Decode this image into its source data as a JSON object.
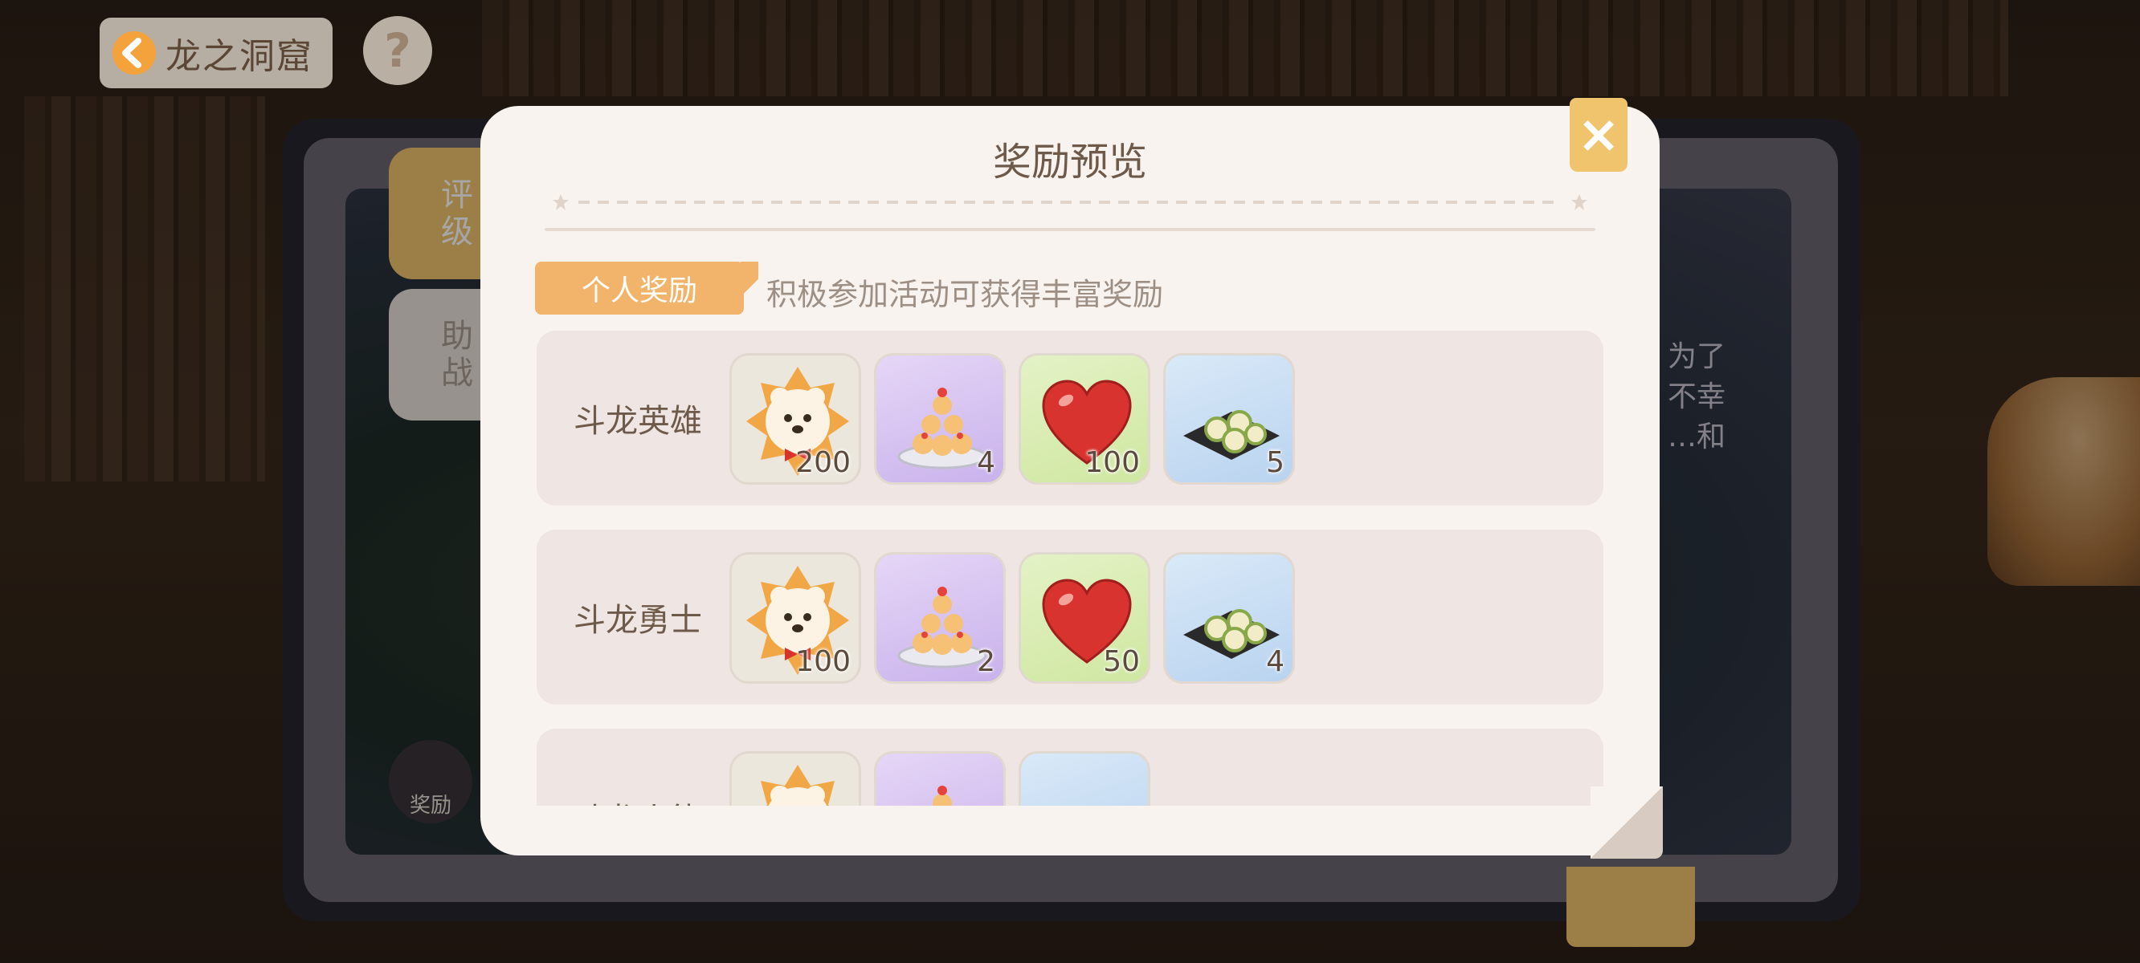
{
  "header": {
    "title": "龙之洞窟",
    "help": "?"
  },
  "tabs": [
    {
      "label_line1": "评",
      "label_line2": "级"
    },
    {
      "label_line1": "助",
      "label_line2": "战"
    }
  ],
  "side_text": {
    "line1": "为了",
    "line2": "不幸",
    "line3": "…和"
  },
  "reward_button": {
    "label": "奖励"
  },
  "modal": {
    "title": "奖励预览",
    "close": "×",
    "section": {
      "tag": "个人奖励",
      "desc": "积极参加活动可获得丰富奖励"
    },
    "rows": [
      {
        "label": "斗龙英雄",
        "items": [
          {
            "icon": "bear-badge-icon",
            "qty": "200"
          },
          {
            "icon": "cake-tower-icon",
            "qty": "4"
          },
          {
            "icon": "heart-icon",
            "qty": "100"
          },
          {
            "icon": "sushi-plate-icon",
            "qty": "5"
          }
        ]
      },
      {
        "label": "斗龙勇士",
        "items": [
          {
            "icon": "bear-badge-icon",
            "qty": "100"
          },
          {
            "icon": "cake-tower-icon",
            "qty": "2"
          },
          {
            "icon": "heart-icon",
            "qty": "50"
          },
          {
            "icon": "sushi-plate-icon",
            "qty": "4"
          }
        ]
      },
      {
        "label": "斗龙小能手",
        "items": [
          {
            "icon": "bear-badge-icon",
            "qty": ""
          },
          {
            "icon": "cake-tower-icon",
            "qty": ""
          },
          {
            "icon": "sushi-plate-icon",
            "qty": ""
          }
        ]
      }
    ]
  },
  "colors": {
    "accent": "#f0c46c",
    "tag": "#f2b46a",
    "text": "#6e5a4a"
  }
}
